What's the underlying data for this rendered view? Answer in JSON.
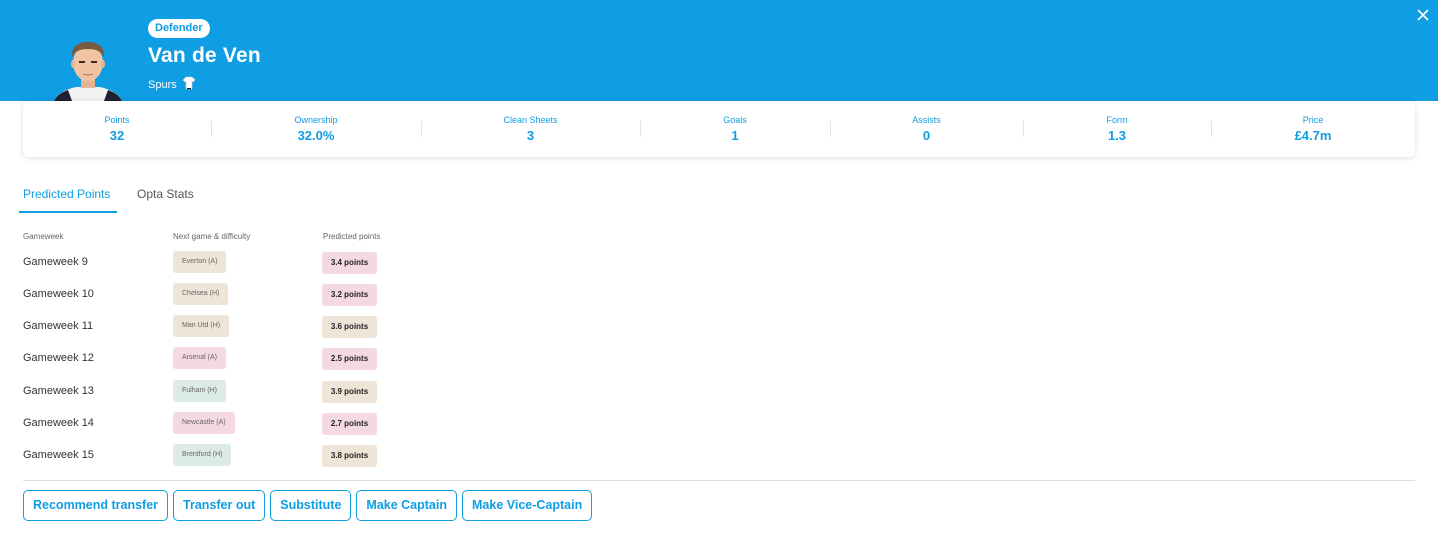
{
  "colors": {
    "accent": "#0f9de3",
    "fixture_easy": "#dcebe3",
    "fixture_medium": "#efe4d8",
    "fixture_hard": "#f5d9e1",
    "points_high": "#efe4d8",
    "points_low": "#f5d9e1"
  },
  "player": {
    "position": "Defender",
    "name": "Van de Ven",
    "team": "Spurs"
  },
  "stats": [
    {
      "label": "Points",
      "value": "32"
    },
    {
      "label": "Ownership",
      "value": "32.0%"
    },
    {
      "label": "Clean Sheets",
      "value": "3"
    },
    {
      "label": "Goals",
      "value": "1"
    },
    {
      "label": "Assists",
      "value": "0"
    },
    {
      "label": "Form",
      "value": "1.3"
    },
    {
      "label": "Price",
      "value": "£4.7m"
    }
  ],
  "tabs": [
    {
      "label": "Predicted Points"
    },
    {
      "label": "Opta Stats"
    }
  ],
  "table": {
    "headers": [
      "Gameweek",
      "Next game & difficulty",
      "Predicted points"
    ],
    "rows": [
      {
        "gameweek": "Gameweek 9",
        "fixture": "Everton (A)",
        "difficulty": "medium",
        "predicted": "3.4 points",
        "tone": "low"
      },
      {
        "gameweek": "Gameweek 10",
        "fixture": "Chelsea (H)",
        "difficulty": "medium",
        "predicted": "3.2 points",
        "tone": "low"
      },
      {
        "gameweek": "Gameweek 11",
        "fixture": "Man Utd (H)",
        "difficulty": "medium",
        "predicted": "3.6 points",
        "tone": "high"
      },
      {
        "gameweek": "Gameweek 12",
        "fixture": "Arsenal (A)",
        "difficulty": "hard",
        "predicted": "2.5 points",
        "tone": "low"
      },
      {
        "gameweek": "Gameweek 13",
        "fixture": "Fulham (H)",
        "difficulty": "easy",
        "predicted": "3.9 points",
        "tone": "high"
      },
      {
        "gameweek": "Gameweek 14",
        "fixture": "Newcastle (A)",
        "difficulty": "hard",
        "predicted": "2.7 points",
        "tone": "low"
      },
      {
        "gameweek": "Gameweek 15",
        "fixture": "Brentford (H)",
        "difficulty": "easy",
        "predicted": "3.8 points",
        "tone": "high"
      }
    ]
  },
  "actions": [
    {
      "label": "Recommend transfer"
    },
    {
      "label": "Transfer out"
    },
    {
      "label": "Substitute"
    },
    {
      "label": "Make Captain"
    },
    {
      "label": "Make Vice-Captain"
    }
  ]
}
